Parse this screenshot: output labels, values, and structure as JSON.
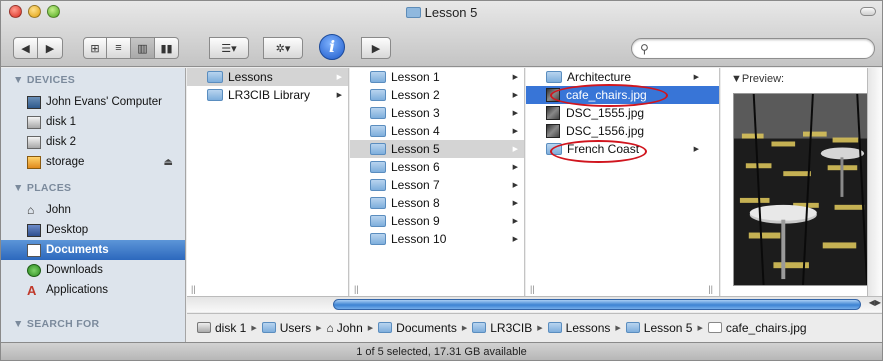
{
  "window": {
    "title": "Lesson 5",
    "status": "1 of 5 selected, 17.31 GB available"
  },
  "toolbar": {
    "back": "◀",
    "forward": "▶",
    "view_icons": "⊞",
    "view_list": "≡",
    "view_columns": "▥",
    "view_coverflow": "▮▮",
    "arrange": "☰▾",
    "action": "✲▾",
    "info": "i",
    "quicklook": "▶"
  },
  "sidebar": {
    "devices_header": "▼ DEVICES",
    "devices": [
      "John Evans' Computer",
      "disk 1",
      "disk 2",
      "storage"
    ],
    "places_header": "▼ PLACES",
    "places": [
      "John",
      "Desktop",
      "Documents",
      "Downloads",
      "Applications"
    ],
    "search_header": "▼ SEARCH FOR"
  },
  "columns": {
    "col1": [
      "Lessons",
      "LR3CIB Library"
    ],
    "col2": [
      "Lesson 1",
      "Lesson 2",
      "Lesson 3",
      "Lesson 4",
      "Lesson 5",
      "Lesson 6",
      "Lesson 7",
      "Lesson 8",
      "Lesson 9",
      "Lesson 10"
    ],
    "col3": [
      "Architecture",
      "cafe_chairs.jpg",
      "DSC_1555.jpg",
      "DSC_1556.jpg",
      "French Coast"
    ]
  },
  "preview": {
    "label": "▼Preview:"
  },
  "path_bar": [
    "disk 1",
    "Users",
    "John",
    "Documents",
    "LR3CIB",
    "Lessons",
    "Lesson 5",
    "cafe_chairs.jpg"
  ],
  "colors": {
    "selection_blue": "#3875d7",
    "annotation_red": "#d0151e",
    "sidebar_bg": "#dde4ec"
  }
}
